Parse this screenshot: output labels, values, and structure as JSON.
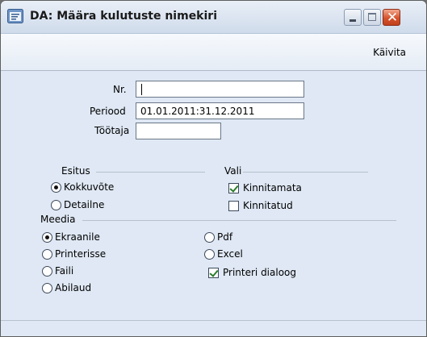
{
  "window": {
    "title": "DA: Määra kulutuste nimekiri",
    "close_glyph": "✕"
  },
  "toolbar": {
    "run_label": "Käivita"
  },
  "fields": {
    "nr": {
      "label": "Nr.",
      "value": ""
    },
    "period": {
      "label": "Periood",
      "value": "01.01.2011:31.12.2011"
    },
    "employee": {
      "label": "Töötaja",
      "value": ""
    }
  },
  "esitus": {
    "label": "Esitus",
    "options": [
      {
        "label": "Kokkuvõte",
        "selected": true
      },
      {
        "label": "Detailne",
        "selected": false
      }
    ]
  },
  "vali": {
    "label": "Vali",
    "options": [
      {
        "label": "Kinnitamata",
        "checked": true
      },
      {
        "label": "Kinnitatud",
        "checked": false
      }
    ]
  },
  "meedia": {
    "label": "Meedia",
    "options": [
      {
        "label": "Ekraanile",
        "selected": true
      },
      {
        "label": "Printerisse",
        "selected": false
      },
      {
        "label": "Faili",
        "selected": false
      },
      {
        "label": "Abilaud",
        "selected": false
      },
      {
        "label": "Pdf",
        "selected": false
      },
      {
        "label": "Excel",
        "selected": false
      }
    ],
    "printer_dialog": {
      "label": "Printeri dialoog",
      "checked": true
    }
  },
  "colors": {
    "title_bg": "#d5e0ee",
    "body_bg": "#dfe8f4",
    "close_btn": "#d5532c",
    "check_mark": "#2a7d2a"
  }
}
